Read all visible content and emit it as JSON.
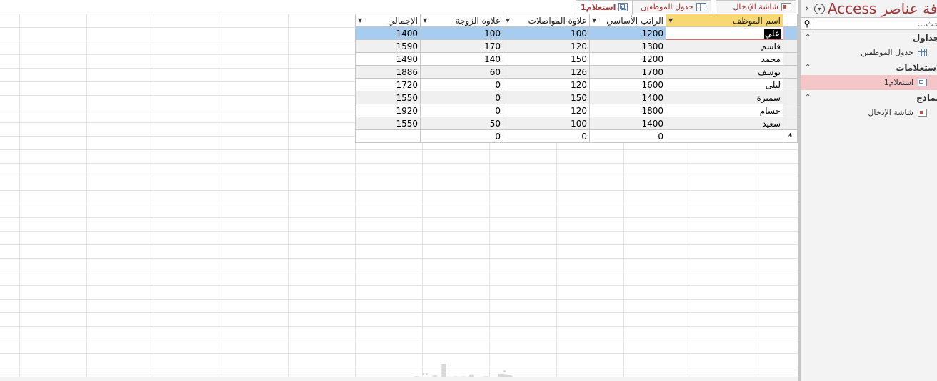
{
  "tabs": [
    {
      "label": "استعلام1",
      "icon": "query-icon",
      "active": true
    },
    {
      "label": "جدول الموظفين",
      "icon": "table-icon",
      "active": false
    },
    {
      "label": "شاشة الإدخال",
      "icon": "form-icon",
      "active": false
    }
  ],
  "datasheet": {
    "columns": [
      "اسم الموظف",
      "الراتب الأساسي",
      "علاوة المواصلات",
      "علاوة الزوجة",
      "الإجمالي"
    ],
    "rows": [
      [
        "علي",
        "1200",
        "100",
        "100",
        "1400"
      ],
      [
        "قاسم",
        "1300",
        "120",
        "170",
        "1590"
      ],
      [
        "محمد",
        "1200",
        "150",
        "140",
        "1490"
      ],
      [
        "يوسف",
        "1700",
        "126",
        "60",
        "1886"
      ],
      [
        "ليلى",
        "1600",
        "120",
        "0",
        "1720"
      ],
      [
        "سميرة",
        "1400",
        "150",
        "0",
        "1550"
      ],
      [
        "حسام",
        "1800",
        "120",
        "0",
        "1920"
      ],
      [
        "سعيد",
        "1400",
        "100",
        "50",
        "1550"
      ]
    ],
    "new_row": [
      "",
      "0",
      "0",
      "0",
      ""
    ],
    "new_row_marker": "*",
    "dropdown_glyph": "▼",
    "selected_row_index": 0
  },
  "watermark": "خمسات",
  "nav": {
    "title": "كافة عناصر Access",
    "menu_glyph": "▾",
    "collapse_glyph": "‹",
    "search_placeholder": "بحث...",
    "search_glyph": "⚲",
    "groups": [
      {
        "label": "الجداول",
        "chevron": "⌃",
        "items": [
          {
            "label": "جدول الموظفين",
            "icon": "table-icon",
            "selected": false
          }
        ]
      },
      {
        "label": "الاستعلامات",
        "chevron": "⌃",
        "items": [
          {
            "label": "استعلام1",
            "icon": "query-icon",
            "selected": true
          }
        ]
      },
      {
        "label": "النماذج",
        "chevron": "⌃",
        "items": [
          {
            "label": "شاشة الإدخال",
            "icon": "form-icon",
            "selected": false
          }
        ]
      }
    ]
  },
  "colors": {
    "accent": "#a4373a",
    "sorted_header": "#f7d873",
    "selected_row": "#a6cdf0",
    "nav_selected": "#f4c6c7"
  }
}
